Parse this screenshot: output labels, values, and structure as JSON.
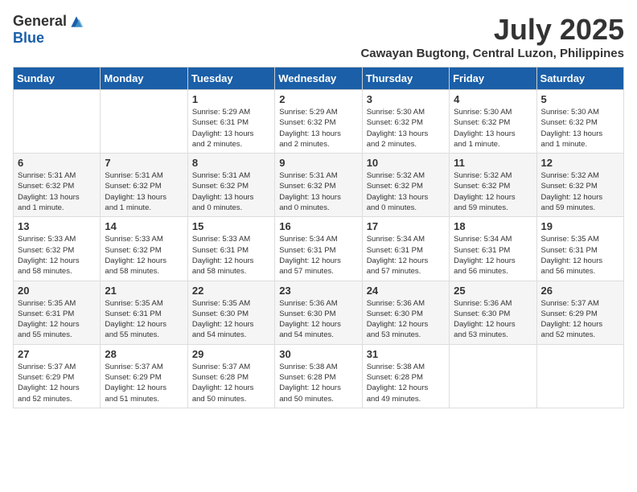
{
  "logo": {
    "general": "General",
    "blue": "Blue"
  },
  "title": {
    "month": "July 2025",
    "location": "Cawayan Bugtong, Central Luzon, Philippines"
  },
  "weekdays": [
    "Sunday",
    "Monday",
    "Tuesday",
    "Wednesday",
    "Thursday",
    "Friday",
    "Saturday"
  ],
  "weeks": [
    [
      {
        "day": "",
        "info": ""
      },
      {
        "day": "",
        "info": ""
      },
      {
        "day": "1",
        "info": "Sunrise: 5:29 AM\nSunset: 6:31 PM\nDaylight: 13 hours\nand 2 minutes."
      },
      {
        "day": "2",
        "info": "Sunrise: 5:29 AM\nSunset: 6:32 PM\nDaylight: 13 hours\nand 2 minutes."
      },
      {
        "day": "3",
        "info": "Sunrise: 5:30 AM\nSunset: 6:32 PM\nDaylight: 13 hours\nand 2 minutes."
      },
      {
        "day": "4",
        "info": "Sunrise: 5:30 AM\nSunset: 6:32 PM\nDaylight: 13 hours\nand 1 minute."
      },
      {
        "day": "5",
        "info": "Sunrise: 5:30 AM\nSunset: 6:32 PM\nDaylight: 13 hours\nand 1 minute."
      }
    ],
    [
      {
        "day": "6",
        "info": "Sunrise: 5:31 AM\nSunset: 6:32 PM\nDaylight: 13 hours\nand 1 minute."
      },
      {
        "day": "7",
        "info": "Sunrise: 5:31 AM\nSunset: 6:32 PM\nDaylight: 13 hours\nand 1 minute."
      },
      {
        "day": "8",
        "info": "Sunrise: 5:31 AM\nSunset: 6:32 PM\nDaylight: 13 hours\nand 0 minutes."
      },
      {
        "day": "9",
        "info": "Sunrise: 5:31 AM\nSunset: 6:32 PM\nDaylight: 13 hours\nand 0 minutes."
      },
      {
        "day": "10",
        "info": "Sunrise: 5:32 AM\nSunset: 6:32 PM\nDaylight: 13 hours\nand 0 minutes."
      },
      {
        "day": "11",
        "info": "Sunrise: 5:32 AM\nSunset: 6:32 PM\nDaylight: 12 hours\nand 59 minutes."
      },
      {
        "day": "12",
        "info": "Sunrise: 5:32 AM\nSunset: 6:32 PM\nDaylight: 12 hours\nand 59 minutes."
      }
    ],
    [
      {
        "day": "13",
        "info": "Sunrise: 5:33 AM\nSunset: 6:32 PM\nDaylight: 12 hours\nand 58 minutes."
      },
      {
        "day": "14",
        "info": "Sunrise: 5:33 AM\nSunset: 6:32 PM\nDaylight: 12 hours\nand 58 minutes."
      },
      {
        "day": "15",
        "info": "Sunrise: 5:33 AM\nSunset: 6:31 PM\nDaylight: 12 hours\nand 58 minutes."
      },
      {
        "day": "16",
        "info": "Sunrise: 5:34 AM\nSunset: 6:31 PM\nDaylight: 12 hours\nand 57 minutes."
      },
      {
        "day": "17",
        "info": "Sunrise: 5:34 AM\nSunset: 6:31 PM\nDaylight: 12 hours\nand 57 minutes."
      },
      {
        "day": "18",
        "info": "Sunrise: 5:34 AM\nSunset: 6:31 PM\nDaylight: 12 hours\nand 56 minutes."
      },
      {
        "day": "19",
        "info": "Sunrise: 5:35 AM\nSunset: 6:31 PM\nDaylight: 12 hours\nand 56 minutes."
      }
    ],
    [
      {
        "day": "20",
        "info": "Sunrise: 5:35 AM\nSunset: 6:31 PM\nDaylight: 12 hours\nand 55 minutes."
      },
      {
        "day": "21",
        "info": "Sunrise: 5:35 AM\nSunset: 6:31 PM\nDaylight: 12 hours\nand 55 minutes."
      },
      {
        "day": "22",
        "info": "Sunrise: 5:35 AM\nSunset: 6:30 PM\nDaylight: 12 hours\nand 54 minutes."
      },
      {
        "day": "23",
        "info": "Sunrise: 5:36 AM\nSunset: 6:30 PM\nDaylight: 12 hours\nand 54 minutes."
      },
      {
        "day": "24",
        "info": "Sunrise: 5:36 AM\nSunset: 6:30 PM\nDaylight: 12 hours\nand 53 minutes."
      },
      {
        "day": "25",
        "info": "Sunrise: 5:36 AM\nSunset: 6:30 PM\nDaylight: 12 hours\nand 53 minutes."
      },
      {
        "day": "26",
        "info": "Sunrise: 5:37 AM\nSunset: 6:29 PM\nDaylight: 12 hours\nand 52 minutes."
      }
    ],
    [
      {
        "day": "27",
        "info": "Sunrise: 5:37 AM\nSunset: 6:29 PM\nDaylight: 12 hours\nand 52 minutes."
      },
      {
        "day": "28",
        "info": "Sunrise: 5:37 AM\nSunset: 6:29 PM\nDaylight: 12 hours\nand 51 minutes."
      },
      {
        "day": "29",
        "info": "Sunrise: 5:37 AM\nSunset: 6:28 PM\nDaylight: 12 hours\nand 50 minutes."
      },
      {
        "day": "30",
        "info": "Sunrise: 5:38 AM\nSunset: 6:28 PM\nDaylight: 12 hours\nand 50 minutes."
      },
      {
        "day": "31",
        "info": "Sunrise: 5:38 AM\nSunset: 6:28 PM\nDaylight: 12 hours\nand 49 minutes."
      },
      {
        "day": "",
        "info": ""
      },
      {
        "day": "",
        "info": ""
      }
    ]
  ]
}
